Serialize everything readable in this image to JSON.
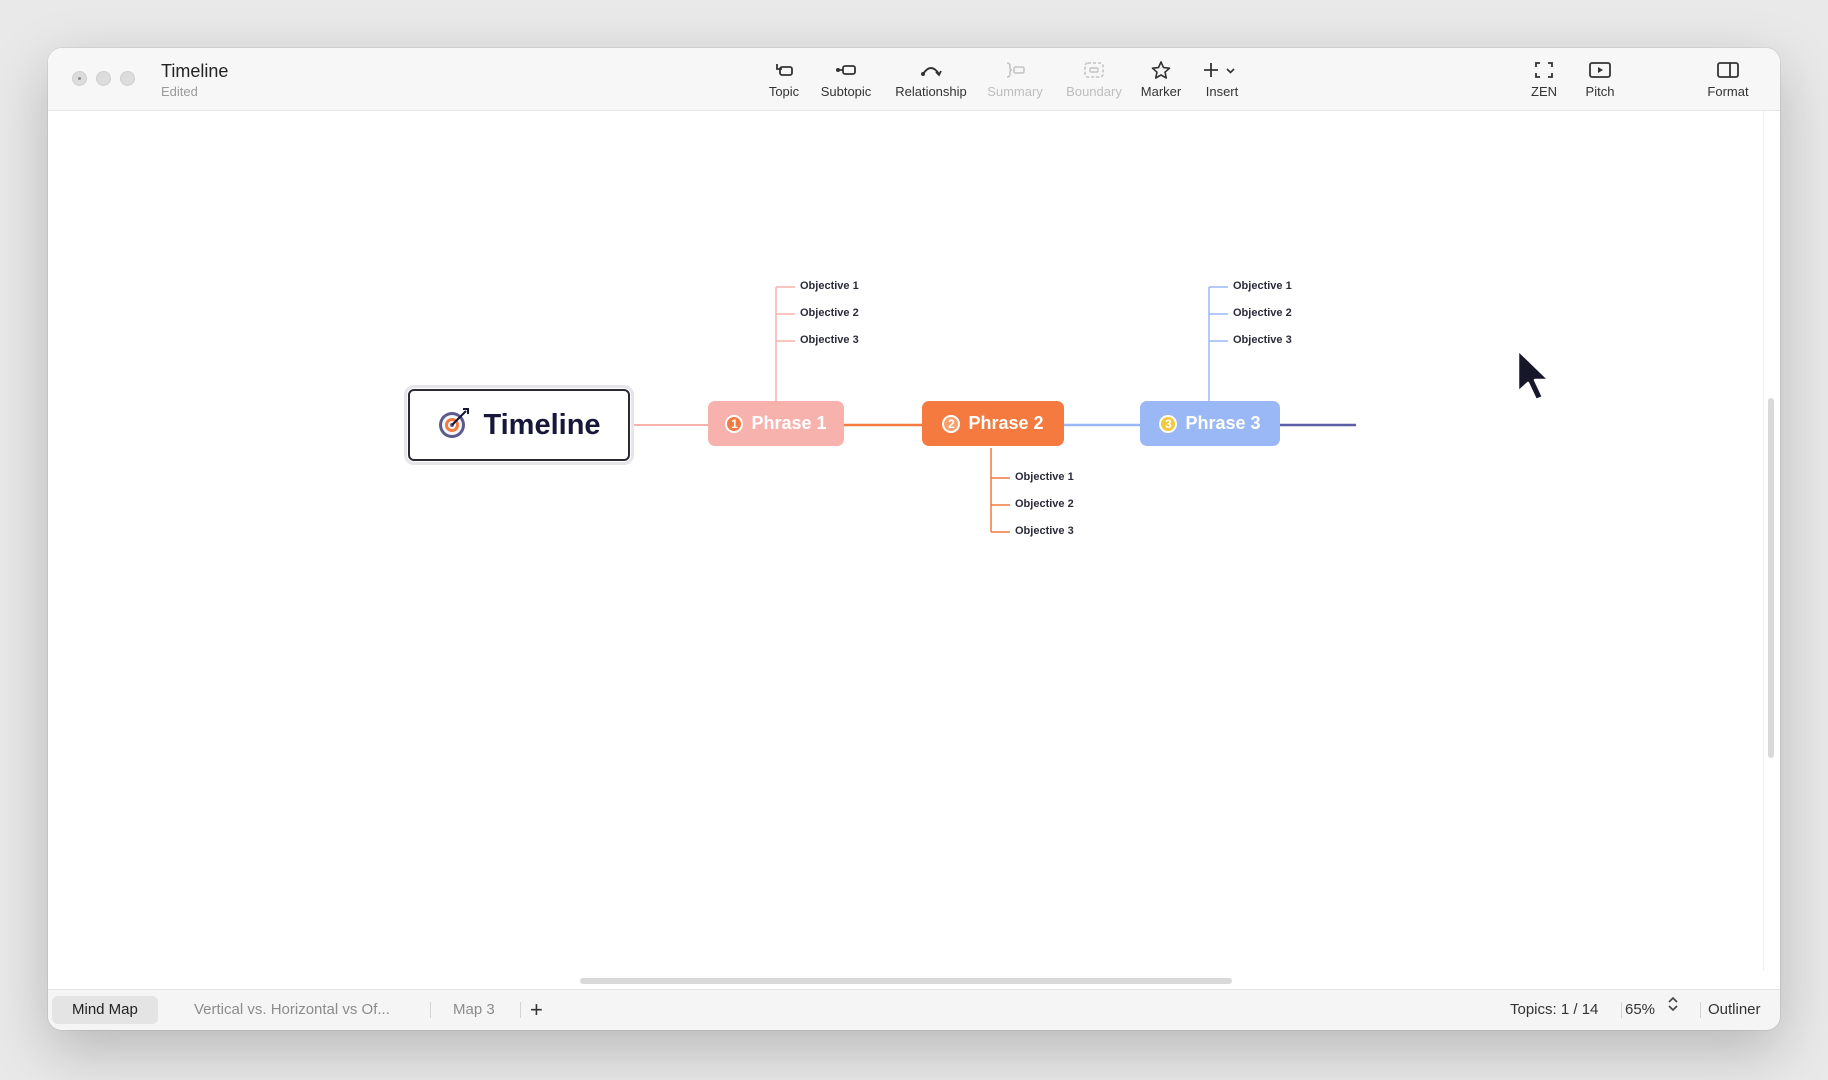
{
  "window": {
    "title": "Timeline",
    "subtitle": "Edited"
  },
  "toolbar": {
    "topic": "Topic",
    "subtopic": "Subtopic",
    "relationship": "Relationship",
    "summary": "Summary",
    "boundary": "Boundary",
    "marker": "Marker",
    "insert": "Insert",
    "zen": "ZEN",
    "pitch": "Pitch",
    "format": "Format"
  },
  "map": {
    "root": "Timeline",
    "phases": [
      {
        "num": "1",
        "label": "Phrase 1",
        "color": "#f8b2ad",
        "objectives": [
          "Objective 1",
          "Objective 2",
          "Objective 3"
        ]
      },
      {
        "num": "2",
        "label": "Phrase 2",
        "color": "#f47a40",
        "objectives": [
          "Objective 1",
          "Objective 2",
          "Objective 3"
        ]
      },
      {
        "num": "3",
        "label": "Phrase 3",
        "color": "#9bb8f6",
        "objectives": [
          "Objective 1",
          "Objective 2",
          "Objective 3"
        ]
      }
    ]
  },
  "bottom": {
    "tabs": [
      "Mind Map",
      "Vertical vs. Horizontal vs Of...",
      "Map 3"
    ],
    "add": "+",
    "topics": "Topics: 1 / 14",
    "zoom": "65%",
    "outliner": "Outliner"
  }
}
